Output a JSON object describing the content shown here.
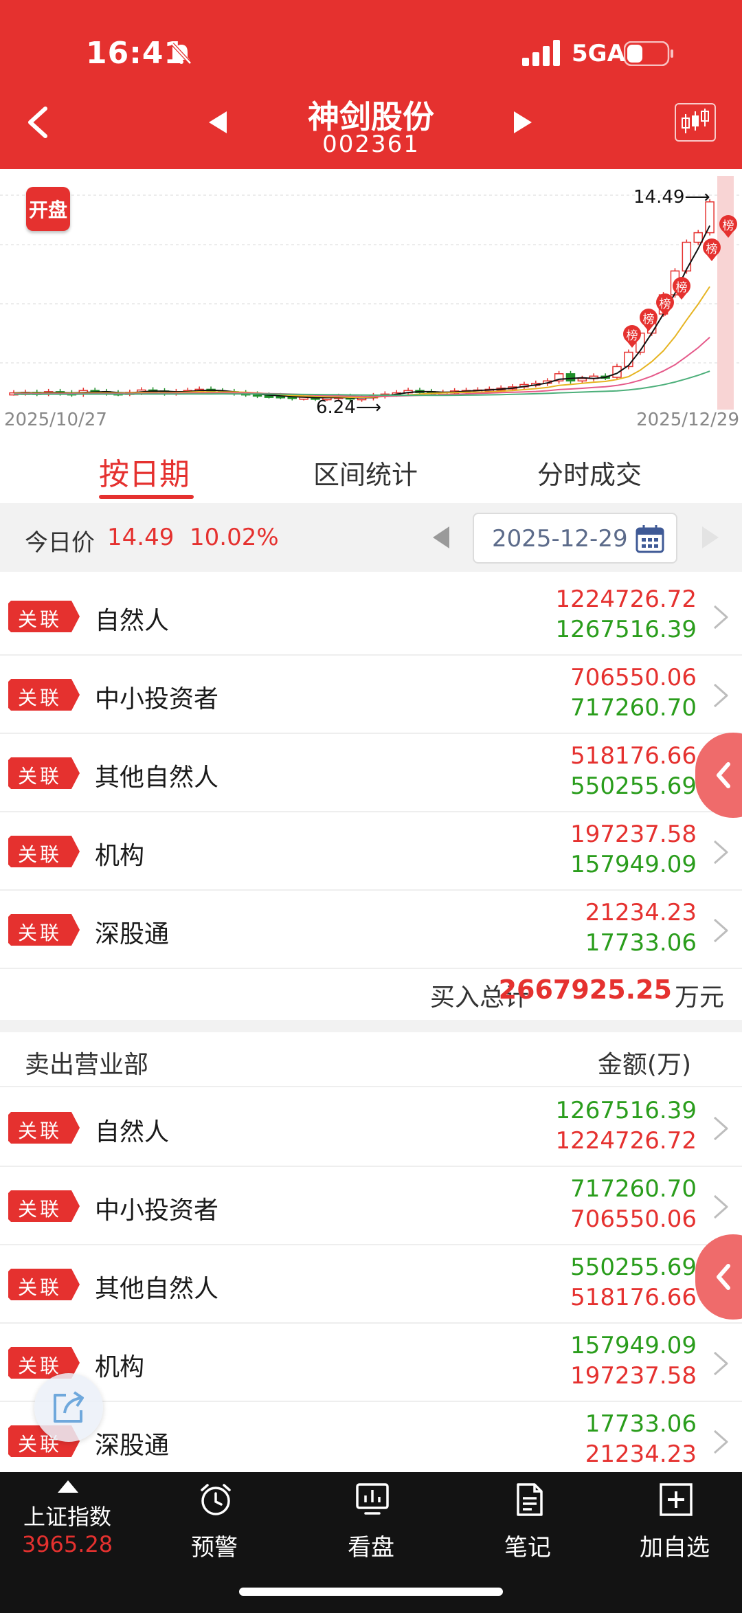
{
  "status_bar": {
    "time": "16:41",
    "network": "5GA"
  },
  "header": {
    "stock_name": "神剑股份",
    "stock_code": "002361"
  },
  "chart": {
    "open_badge": "开盘",
    "date_start": "2025/10/27",
    "date_end": "2025/12/29",
    "max_label": "14.49⟶",
    "min_label": "6.24⟶",
    "board_tag": "榜"
  },
  "chart_data": {
    "type": "candlestick",
    "x_range": [
      "2025/10/27",
      "2025/12/29"
    ],
    "annotations": [
      {
        "label": "14.49",
        "kind": "max_price"
      },
      {
        "label": "6.24",
        "kind": "min_price"
      }
    ],
    "moving_averages": 4
  },
  "tabs": [
    {
      "label": "按日期",
      "active": true
    },
    {
      "label": "区间统计",
      "active": false
    },
    {
      "label": "分时成交",
      "active": false
    }
  ],
  "today": {
    "label": "今日价",
    "price": "14.49",
    "pct": "10.02%",
    "date": "2025-12-29"
  },
  "buy_rows": [
    {
      "tag": "关联",
      "name": "自然人",
      "buy": "1224726.72",
      "sell": "1267516.39"
    },
    {
      "tag": "关联",
      "name": "中小投资者",
      "buy": "706550.06",
      "sell": "717260.70"
    },
    {
      "tag": "关联",
      "name": "其他自然人",
      "buy": "518176.66",
      "sell": "550255.69"
    },
    {
      "tag": "关联",
      "name": "机构",
      "buy": "197237.58",
      "sell": "157949.09"
    },
    {
      "tag": "关联",
      "name": "深股通",
      "buy": "21234.23",
      "sell": "17733.06"
    }
  ],
  "buy_total": {
    "label": "买入总计",
    "value": "2667925.25",
    "unit": "万元"
  },
  "sell_header": {
    "title": "卖出营业部",
    "amount": "金额(万)"
  },
  "sell_rows": [
    {
      "tag": "关联",
      "name": "自然人",
      "sell": "1267516.39",
      "buy": "1224726.72"
    },
    {
      "tag": "关联",
      "name": "中小投资者",
      "sell": "717260.70",
      "buy": "706550.06"
    },
    {
      "tag": "关联",
      "name": "其他自然人",
      "sell": "550255.69",
      "buy": "518176.66"
    },
    {
      "tag": "关联",
      "name": "机构",
      "sell": "157949.09",
      "buy": "197237.58"
    },
    {
      "tag": "关联",
      "name": "深股通",
      "sell": "17733.06",
      "buy": "21234.23"
    }
  ],
  "bottom_nav": {
    "index_name": "上证指数",
    "index_value": "3965.28",
    "items": [
      {
        "label": "预警",
        "icon": "alarm-clock-icon"
      },
      {
        "label": "看盘",
        "icon": "monitor-chart-icon"
      },
      {
        "label": "笔记",
        "icon": "notes-icon"
      },
      {
        "label": "加自选",
        "icon": "add-favorite-icon"
      }
    ]
  },
  "colors": {
    "brand_red": "#e5312f",
    "up_red": "#e5312f",
    "down_green": "#2a9d1c",
    "nav_bg": "#131313"
  }
}
